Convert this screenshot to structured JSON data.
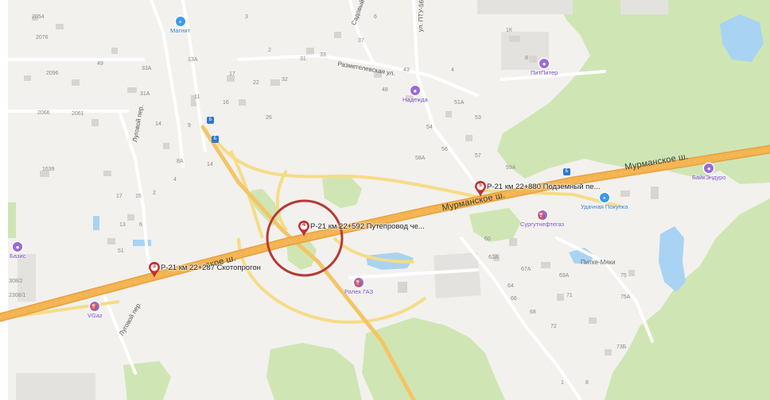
{
  "colors": {
    "background": "#f2f1ee",
    "forest": "#cfe6b4",
    "water": "#a9d3f2",
    "highway": "#f3b451",
    "road": "#f6dc86",
    "camera_red": "#c42f2f",
    "highlight_circle": "#b63a34"
  },
  "highway": {
    "label_left": "ское ш.",
    "label_mid": "Мурманское ш.",
    "label_right": "Мурманское ш."
  },
  "cameras": [
    {
      "num": "3",
      "text": "Р-21 км 22+287 Скотопрогон"
    },
    {
      "num": "4",
      "text": "Р-21 км 22+592 Путепровод че..."
    },
    {
      "num": "5",
      "text": "Р-21 км 22+880 Подземный пе..."
    }
  ],
  "pois": {
    "magnit": {
      "name": "Магнит",
      "icon": "shopping-bag-icon"
    },
    "pitpiter": {
      "name": "ПитПитер",
      "icon": "shop-icon"
    },
    "nadezhda": {
      "name": "Надежда",
      "icon": "shop-icon"
    },
    "bayk_enduro": {
      "name": "БайкЭндуро",
      "icon": "motorcycle-icon"
    },
    "udachnaya_pokupka": {
      "name": "Удачная Покупка",
      "icon": "shopping-bag-icon"
    },
    "surgutneftegaz": {
      "name": "Сургутнефтегаз",
      "icon": "fuel-icon"
    },
    "ralex_gaz": {
      "name": "Ралех ГАЗ",
      "icon": "fuel-icon"
    },
    "vgaz": {
      "name": "VGaz",
      "icon": "fuel-icon"
    },
    "bazis": {
      "name": "Базис",
      "icon": "shop-icon"
    }
  },
  "streets": {
    "razmetelevskaya": "Разметелевская ул.",
    "lugovoy_1": "Луговой пер.",
    "lugovoy_2": "Луговой пер.",
    "sadovy": "Садовый",
    "pttv": "ул. ПТУ-56"
  },
  "area_names": {
    "pitke_myaki": "Питке-Мяки"
  },
  "house_numbers": {
    "h2054": "2054",
    "h2076": "2076",
    "h2096": "2096",
    "h2066": "2066",
    "h2061": "2061",
    "h49": "49",
    "h33a": "33А",
    "h13a": "13А",
    "h31a": "31А",
    "h17": "17",
    "h22": "22",
    "h32": "32",
    "h31": "31",
    "h33": "33",
    "h3": "3",
    "h6": "6",
    "h37": "37",
    "h2": "2",
    "h11": "11",
    "h16": "16",
    "h26": "26",
    "h14": "14",
    "h9": "9",
    "h8a": "8А",
    "h4": "4",
    "h14b": "14",
    "h1639": "1639",
    "h17b": "17",
    "h15": "15",
    "h2b": "2",
    "h13": "13",
    "h6b": "6",
    "h51": "51",
    "h3082": "308/2",
    "h23081": "2308/1",
    "h43": "43",
    "h48": "48",
    "h51a": "51А",
    "h54": "54",
    "h53": "53",
    "h56": "56",
    "h57": "57",
    "h58a": "58А",
    "h59a": "59А",
    "h1k": "1К",
    "h8": "8",
    "h60": "60",
    "h62a": "62А",
    "h64": "64",
    "h66": "66",
    "h67a": "67А",
    "h68": "68",
    "h69a": "69А",
    "h71": "71",
    "h72": "72",
    "h75": "75",
    "h75a": "75А",
    "h73b": "73Б",
    "h4b": "4",
    "h1": "1",
    "h8b": "8"
  }
}
